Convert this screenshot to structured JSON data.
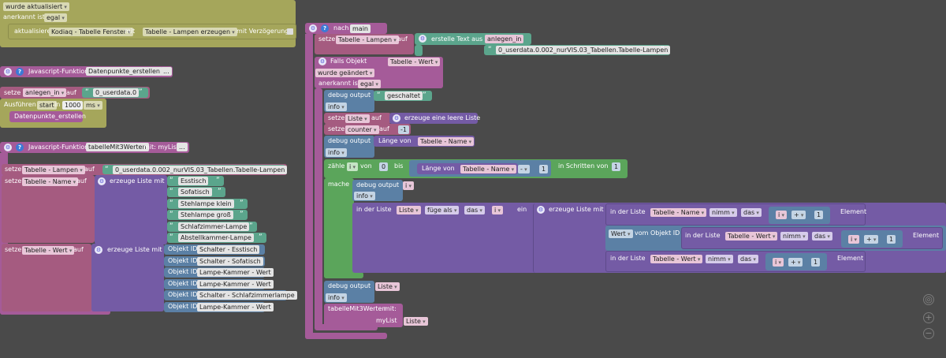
{
  "colors": {
    "background": "#4a4a4a",
    "olive": "#a5a65b",
    "purple": "#a55b99",
    "violet": "#745ba5",
    "teal": "#5ba58c",
    "green": "#5ba55b",
    "blue": "#5b80a5",
    "red": "#a55b5b",
    "plum": "#a55b80"
  },
  "top_block": {
    "line1": "wurde aktualisiert",
    "line2_label": "anerkannt ist",
    "line2_value": "egal",
    "aktualisiere": "aktualisiere",
    "device": "Kodiaq - Tabelle Fenster",
    "mit": "mit",
    "value": "Tabelle - Lampen erzeugen",
    "delay": "mit Verzögerung"
  },
  "func1": {
    "label": "Javascript-Funktion",
    "name": "Datenpunkte_erstellen",
    "more": "..."
  },
  "setze1": {
    "setze": "setze",
    "var": "anlegen_in",
    "auf": "auf",
    "value": "0_userdata.0",
    "run": "Ausführen",
    "start": "start",
    "in": "in",
    "ms_value": "1000",
    "unit": "ms",
    "call": "Datenpunkte_erstellen"
  },
  "func2": {
    "label": "Javascript-Funktion",
    "name": "tabelleMit3Werten",
    "mit": "mit: myList",
    "more": "..."
  },
  "setze_lampen": {
    "setze": "setze",
    "var": "Tabelle - Lampen",
    "auf": "auf",
    "value": "0_userdata.0.002_nurVIS.03_Tabellen.Tabelle-Lampen"
  },
  "setze_name": {
    "setze": "setze",
    "var": "Tabelle - Name",
    "auf": "auf",
    "create": "erzeuge Liste mit",
    "items": [
      "Esstisch",
      "Sofatisch",
      "Stehlampe klein",
      "Stehlampe groß",
      "Schlafzimmer-Lampe",
      "Abstellkammer-Lampe"
    ]
  },
  "setze_wert": {
    "setze": "setze",
    "var": "Tabelle - Wert",
    "auf": "auf",
    "create": "erzeuge Liste mit",
    "objid": "Objekt ID",
    "items": [
      "Schalter - Esstisch",
      "Schalter - Sofatisch",
      "Lampe-Kammer - Wert",
      "Lampe-Kammer - Wert",
      "Schalter - Schlafzimmerlampe",
      "Lampe-Kammer - Wert"
    ]
  },
  "main": {
    "nach": "nach",
    "main_tag": "main",
    "setze": "setze",
    "var_lampen": "Tabelle - Lampen",
    "auf": "auf",
    "erstelle": "erstelle Text aus",
    "anlegen": "anlegen_in",
    "path": "0_userdata.0.002_nurVIS.03_Tabellen.Tabelle-Lampen",
    "falls": "Falls Objekt",
    "falls_var": "Tabelle - Wert",
    "geandert": "wurde geändert",
    "anerkannt": "anerkannt ist",
    "egal": "egal",
    "debug": "debug output",
    "info": "info",
    "geschaltet": "geschaltet",
    "liste": "Liste",
    "leere": "erzeuge eine leere Liste",
    "counter": "counter",
    "minus1": "-1",
    "laenge": "Länge von",
    "tab_name": "Tabelle - Name",
    "tab_wert": "Tabelle - Wert",
    "zaehle": "zähle",
    "i": "i",
    "von": "von",
    "zero": "0",
    "bis": "bis",
    "minus": "-",
    "one": "1",
    "schritte": "in Schritten von",
    "mache": "mache",
    "in_liste": "in der Liste",
    "fuege": "füge als",
    "das": "das",
    "ein": "ein",
    "erzeuge_liste": "erzeuge Liste mit",
    "nimm": "nimm",
    "plus": "+",
    "element": "Element",
    "wert": "Wert",
    "vom": "vom Objekt ID",
    "call": "tabelleMit3Werten",
    "mit": "mit:",
    "myList": "myList"
  },
  "controls": {
    "target": "◎",
    "zoom_in": "+",
    "zoom_out": "−"
  }
}
